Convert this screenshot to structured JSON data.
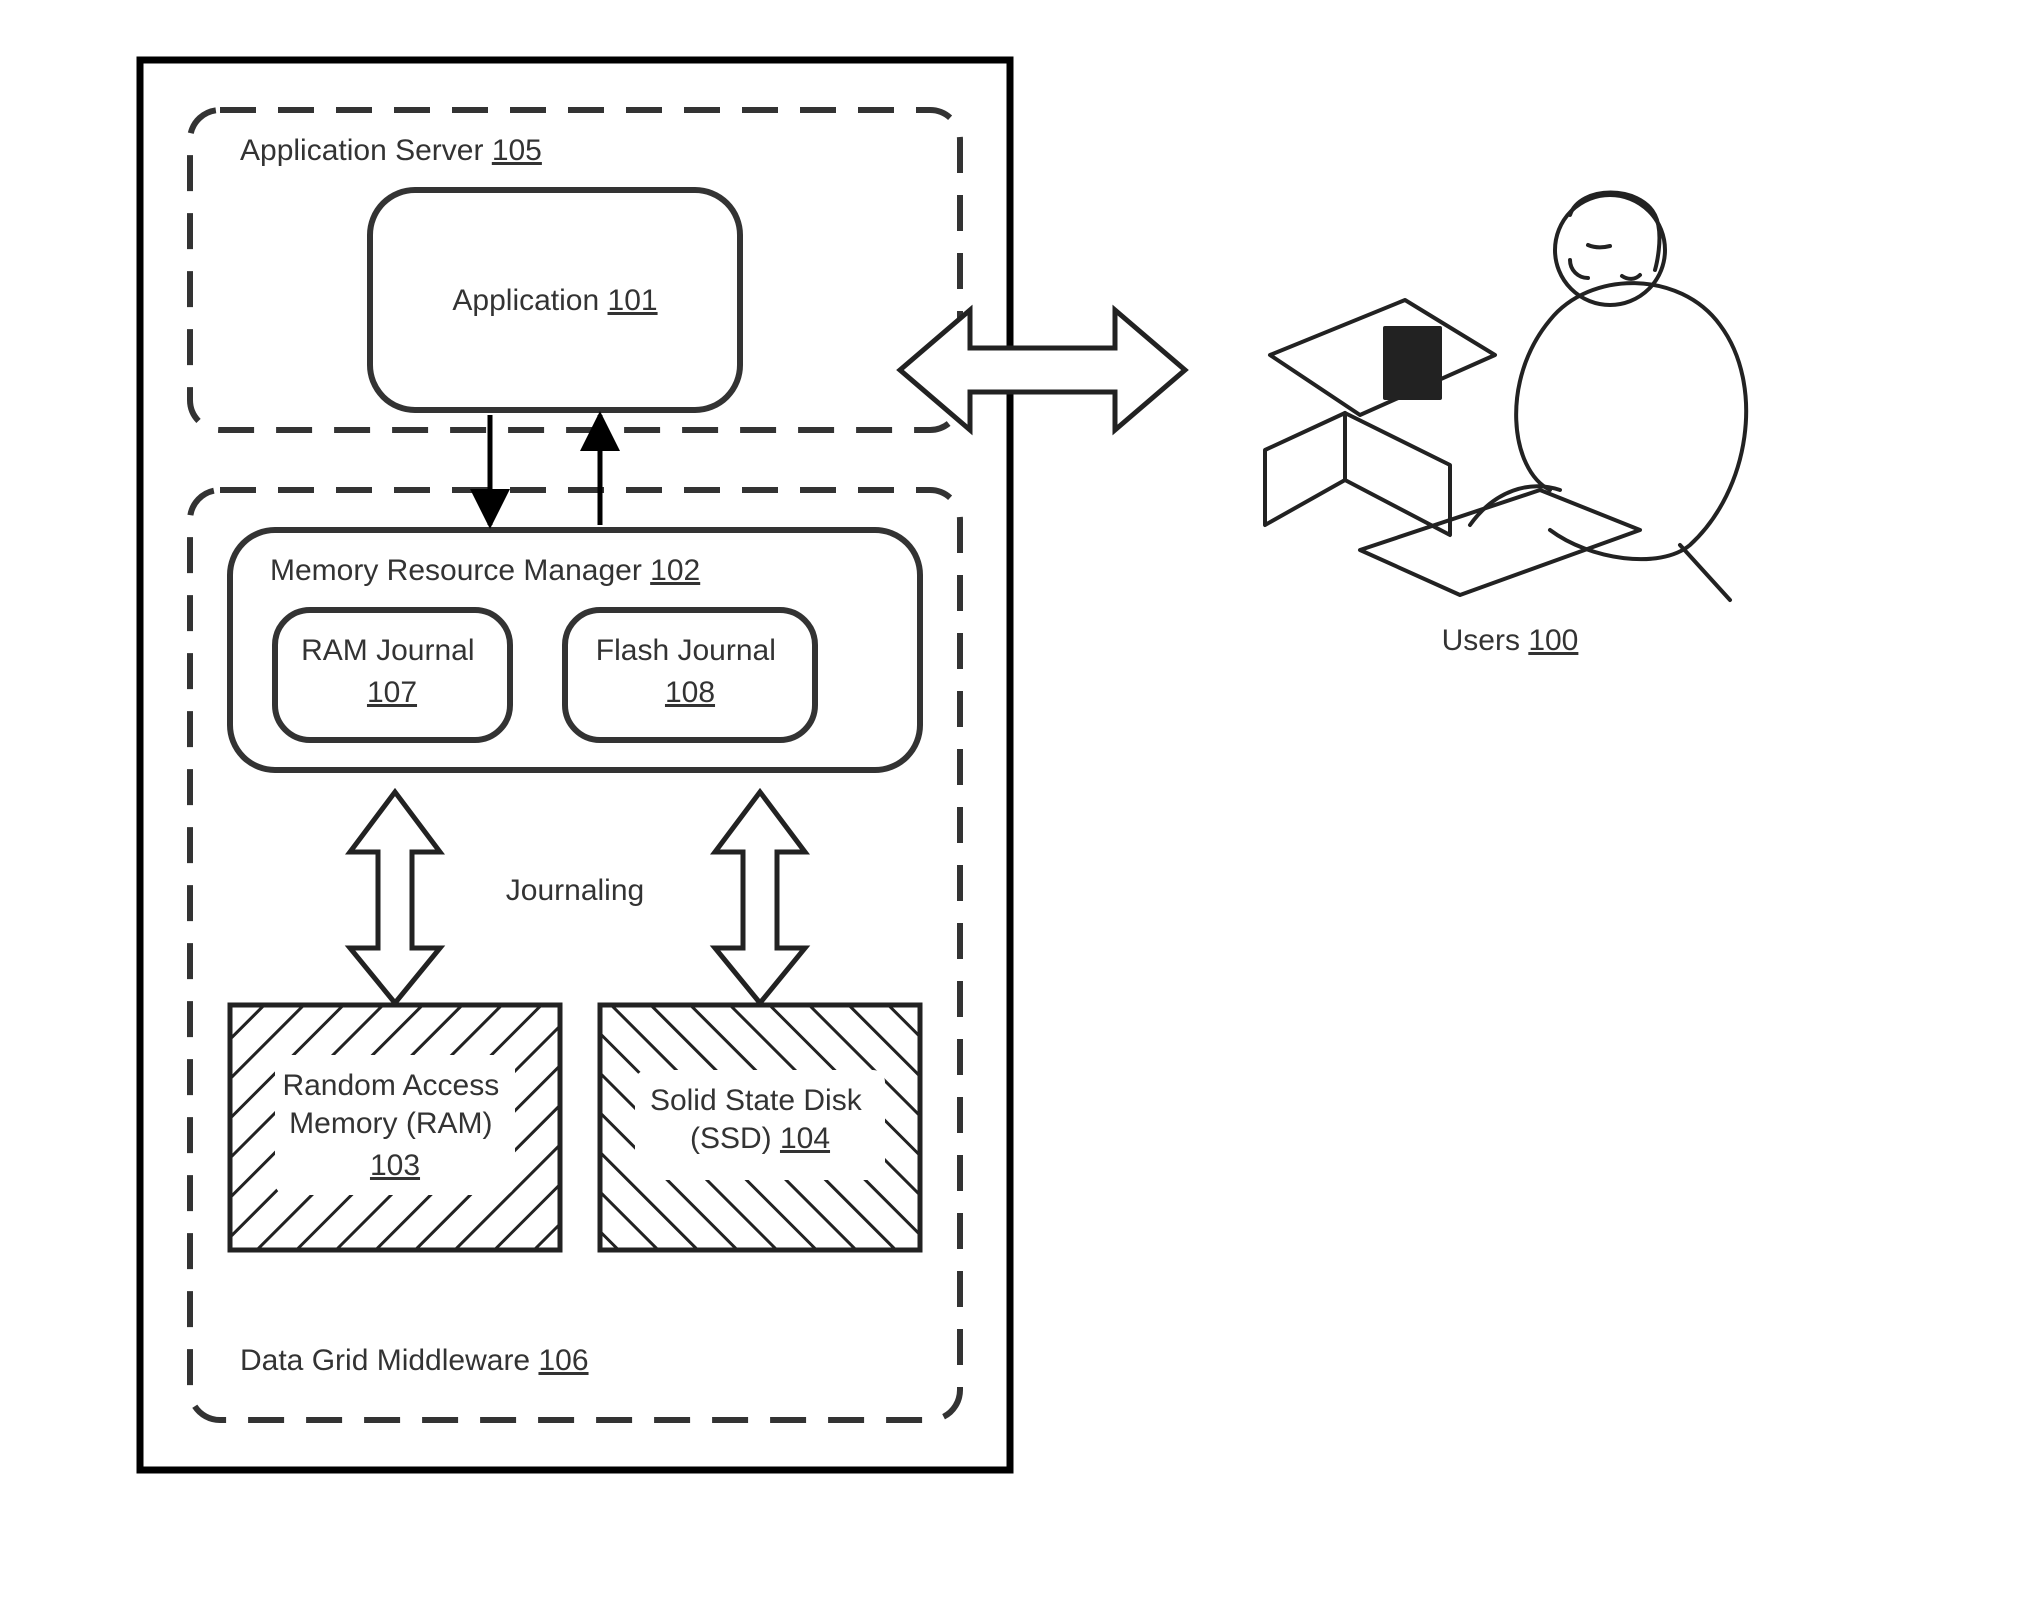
{
  "app_server": {
    "label": "Application Server",
    "ref": "105"
  },
  "application": {
    "label": "Application",
    "ref": "101"
  },
  "mrm": {
    "label": "Memory Resource Manager",
    "ref": "102"
  },
  "ram_journal": {
    "label": "RAM Journal",
    "ref": "107"
  },
  "flash_journal": {
    "label": "Flash Journal",
    "ref": "108"
  },
  "journaling": {
    "label": "Journaling"
  },
  "ram": {
    "line1": "Random Access",
    "line2": "Memory (RAM)",
    "ref": "103"
  },
  "ssd": {
    "line1": "Solid State Disk",
    "line2": "(SSD)",
    "ref": "104"
  },
  "middleware": {
    "label": "Data Grid Middleware",
    "ref": "106"
  },
  "users": {
    "label": "Users",
    "ref": "100"
  }
}
